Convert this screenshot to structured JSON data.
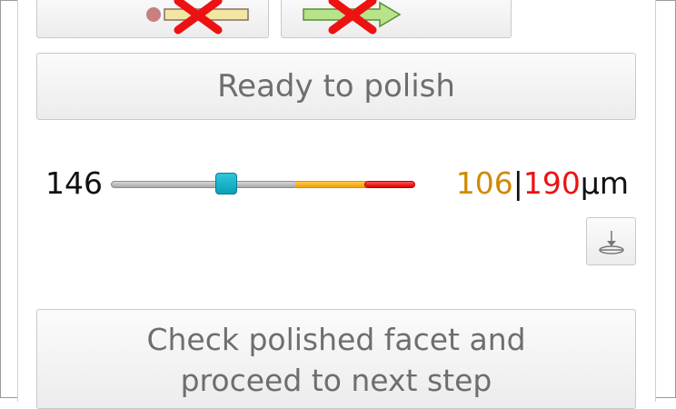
{
  "toolbar": {
    "left_button_icon": "remove-start-arrow-icon",
    "right_button_icon": "remove-forward-arrow-icon"
  },
  "status_button": {
    "label": "Ready to polish"
  },
  "slider": {
    "current_value": "146",
    "warning_limit": "106",
    "separator": "|",
    "danger_limit": "190",
    "unit": "µm",
    "handle_position_fraction": 0.37,
    "colors": {
      "normal": "#a8a8a8",
      "warning": "#f0a100",
      "danger": "#e00000",
      "handle": "#0aa0b9"
    }
  },
  "side_tool": {
    "icon": "drop-down-tool-icon"
  },
  "next_step_button": {
    "line1": "Check polished facet and",
    "line2": "proceed to next step"
  },
  "colors": {
    "button_text": "#6e6e6e",
    "warning_text": "#d18a00",
    "danger_text": "#ee1111"
  }
}
